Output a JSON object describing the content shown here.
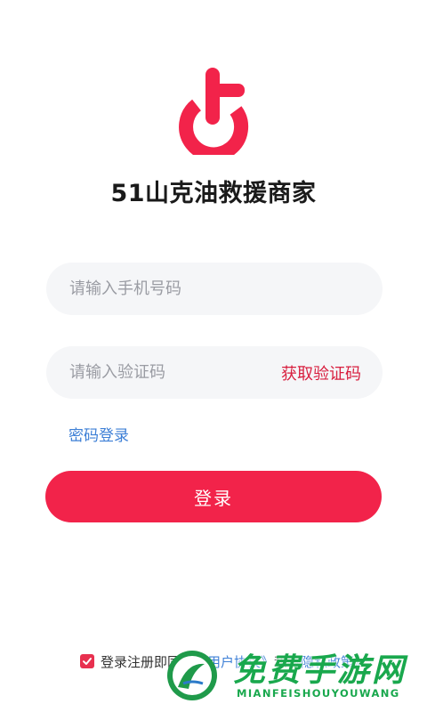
{
  "app": {
    "title": "51山克油救援商家"
  },
  "colors": {
    "brand": "#f2234a",
    "link": "#3d7fd6",
    "field_bg": "#f5f6f8"
  },
  "login_form": {
    "phone_placeholder": "请输入手机号码",
    "code_placeholder": "请输入验证码",
    "get_code_label": "获取验证码",
    "password_login_label": "密码登录",
    "submit_label": "登录"
  },
  "agreement": {
    "checked": true,
    "prefix": "登录注册即同意",
    "user_agreement": "《用户协议》",
    "connector": "和",
    "privacy_policy": "《隐私政策》"
  },
  "watermark": {
    "title": "免费手游网",
    "subtitle": "MIANFEISHOUYOUWANG"
  }
}
